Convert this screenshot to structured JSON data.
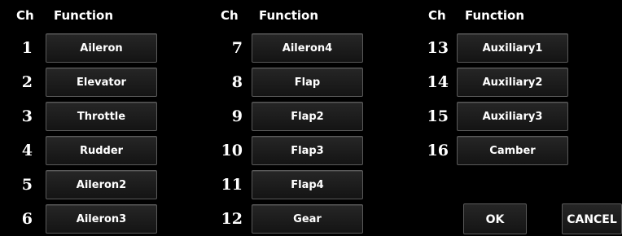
{
  "headers": {
    "ch_label": "Ch",
    "function_label": "Function"
  },
  "channels": [
    {
      "ch": "1",
      "function": "Aileron"
    },
    {
      "ch": "2",
      "function": "Elevator"
    },
    {
      "ch": "3",
      "function": "Throttle"
    },
    {
      "ch": "4",
      "function": "Rudder"
    },
    {
      "ch": "5",
      "function": "Aileron2"
    },
    {
      "ch": "6",
      "function": "Aileron3"
    },
    {
      "ch": "7",
      "function": "Aileron4"
    },
    {
      "ch": "8",
      "function": "Flap"
    },
    {
      "ch": "9",
      "function": "Flap2"
    },
    {
      "ch": "10",
      "function": "Flap3"
    },
    {
      "ch": "11",
      "function": "Flap4"
    },
    {
      "ch": "12",
      "function": "Gear"
    },
    {
      "ch": "13",
      "function": "Auxiliary1"
    },
    {
      "ch": "14",
      "function": "Auxiliary2"
    },
    {
      "ch": "15",
      "function": "Auxiliary3"
    },
    {
      "ch": "16",
      "function": "Camber"
    }
  ],
  "actions": {
    "ok_label": "OK",
    "cancel_label": "CANCEL"
  },
  "colors": {
    "background": "#000000",
    "button_border": "#5a5a5a",
    "text": "#ffffff"
  }
}
